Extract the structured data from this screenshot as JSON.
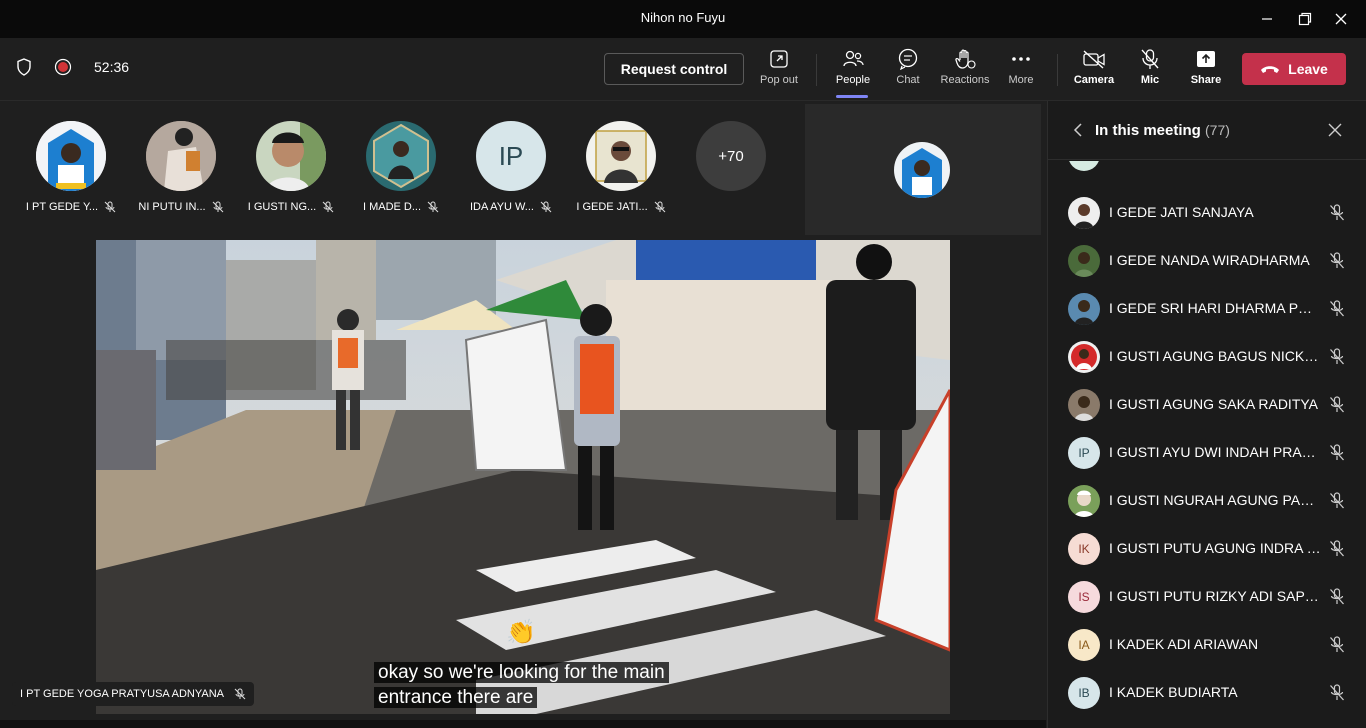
{
  "window": {
    "title": "Nihon no Fuyu"
  },
  "toolbar": {
    "timer": "52:36",
    "request_control": "Request control",
    "pop_out": "Pop out",
    "people": "People",
    "chat": "Chat",
    "reactions": "Reactions",
    "more": "More",
    "camera": "Camera",
    "mic": "Mic",
    "share": "Share",
    "leave": "Leave"
  },
  "strip": {
    "participants": [
      {
        "name": "I PT GEDE Y...",
        "avatar": "photo"
      },
      {
        "name": "NI PUTU IN...",
        "avatar": "photo"
      },
      {
        "name": "I GUSTI NG...",
        "avatar": "photo"
      },
      {
        "name": "I MADE D...",
        "avatar": "photo"
      },
      {
        "name": "IDA AYU W...",
        "avatar": "initials",
        "initials": "IP"
      },
      {
        "name": "I GEDE JATI...",
        "avatar": "photo"
      }
    ],
    "overflow": "+70"
  },
  "stage": {
    "caption_line1": "okay so we're looking for the main",
    "caption_line2": "entrance there are",
    "speaker": "I PT GEDE YOGA PRATYUSA ADNYANA"
  },
  "panel": {
    "title": "In this meeting",
    "count": "(77)",
    "people": [
      {
        "name": "I GEDE JATI SANJAYA",
        "avatar": "photo"
      },
      {
        "name": "I GEDE NANDA WIRADHARMA",
        "avatar": "photo"
      },
      {
        "name": "I GEDE SRI HARI DHARMA PUTRA",
        "avatar": "photo"
      },
      {
        "name": "I GUSTI AGUNG BAGUS NICKTO ...",
        "avatar": "photo"
      },
      {
        "name": "I GUSTI AGUNG SAKA RADITYA",
        "avatar": "photo"
      },
      {
        "name": "I GUSTI AYU DWI INDAH PRADN...",
        "avatar": "initials",
        "initials": "IP"
      },
      {
        "name": "I GUSTI NGURAH AGUNG PANJI...",
        "avatar": "photo"
      },
      {
        "name": "I GUSTI PUTU AGUNG INDRA K...",
        "avatar": "initials",
        "initials": "IK"
      },
      {
        "name": "I GUSTI PUTU RIZKY ADI SAPUT...",
        "avatar": "initials",
        "initials": "IS"
      },
      {
        "name": "I KADEK ADI ARIAWAN",
        "avatar": "initials",
        "initials": "IA"
      },
      {
        "name": "I KADEK BUDIARTA",
        "avatar": "initials",
        "initials": "IB"
      }
    ]
  },
  "colors": {
    "leave": "#c4314b",
    "accent": "#7f85f5",
    "record": "#d13438"
  }
}
